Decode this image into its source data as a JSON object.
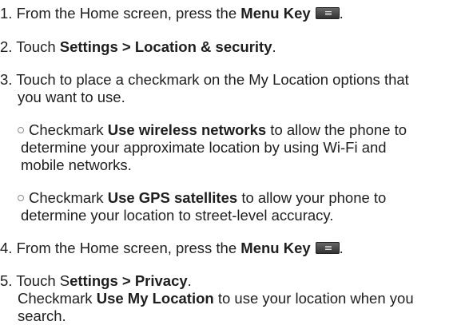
{
  "steps": [
    {
      "num": "1.",
      "pre": " From the Home screen, press the ",
      "bold": "Menu Key",
      "icon": "menu-key-icon"
    },
    {
      "num": "2.",
      "pre": " Touch ",
      "bold": "Settings > Location & security",
      "post": "."
    },
    {
      "num": "3.",
      "line1": " Touch to place a checkmark on the My Location options that",
      "line2": "you want to use."
    },
    {
      "num": "4.",
      "pre": " From the Home screen, press the ",
      "bold": "Menu Key",
      "icon": "menu-key-icon"
    },
    {
      "num": "5.",
      "pre": " Touch S",
      "bold": "ettings > Privacy",
      "post": ".",
      "line2_pre": "Checkmark ",
      "line2_bold": "Use My Location",
      "line2_post": " to use your location when you",
      "line3": "search."
    }
  ],
  "sub_items": [
    {
      "pre": "Checkmark ",
      "bold": "Use wireless networks",
      "post": " to allow the phone to",
      "line2": "determine your approximate location by using Wi-Fi and",
      "line3": "mobile networks."
    },
    {
      "pre": "Checkmark ",
      "bold": "Use GPS satellites",
      "post": " to allow your phone to",
      "line2": "determine your location to street-level accuracy."
    }
  ]
}
